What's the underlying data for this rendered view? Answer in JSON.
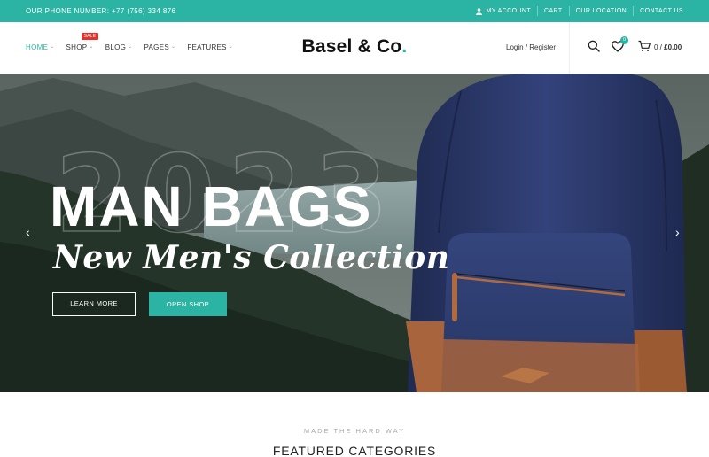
{
  "topbar": {
    "phone": "OUR PHONE NUMBER: +77 (756) 334 876",
    "links": [
      "MY ACCOUNT",
      "CART",
      "OUR LOCATION",
      "CONTACT US"
    ]
  },
  "header": {
    "nav": [
      {
        "label": "HOME",
        "active": true
      },
      {
        "label": "SHOP",
        "badge": "SALE"
      },
      {
        "label": "BLOG"
      },
      {
        "label": "PAGES"
      },
      {
        "label": "FEATURES"
      }
    ],
    "logo_text": "Basel & Co",
    "logo_dot": ".",
    "login": "Login / Register",
    "wishlist_count": "0",
    "cart_count": "0 / ",
    "cart_amount": "£0.00"
  },
  "hero": {
    "year": "2023",
    "headline": "MAN BAGS",
    "subline": "New Men's Collection",
    "learn_more": "LEARN MORE",
    "open_shop": "OPEN SHOP",
    "prev_arrow": "‹",
    "next_arrow": "›"
  },
  "featured": {
    "eyebrow": "MADE THE HARD WAY",
    "title": "FEATURED CATEGORIES"
  },
  "colors": {
    "accent": "#2bb3a3",
    "sale": "#e4312b"
  }
}
